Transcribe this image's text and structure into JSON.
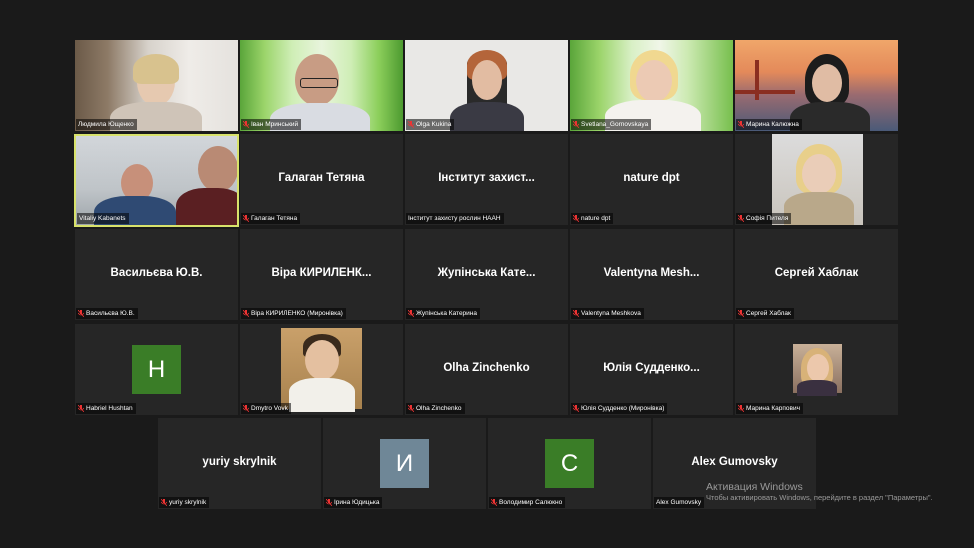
{
  "participants": [
    {
      "label": "Людмила Ющенко",
      "video": true
    },
    {
      "label": "Іван Мринський",
      "video": true
    },
    {
      "label": "Olga Kukina",
      "video": true
    },
    {
      "label": "Svetlana_Gornovskaya",
      "video": true
    },
    {
      "label": "Марина Калюжна",
      "video": true
    },
    {
      "label": "Vitaliy Kabanets",
      "video": true,
      "active": true
    },
    {
      "label": "Галаган Тетяна",
      "name": "Галаган Тетяна"
    },
    {
      "label": "Інститут захисту рослин НААН",
      "name": "Інститут захист..."
    },
    {
      "label": "nature dpt",
      "name": "nature dpt"
    },
    {
      "label": "Софія Пителя",
      "video": true
    },
    {
      "label": "Васильєва Ю.В.",
      "name": "Васильєва Ю.В."
    },
    {
      "label": "Віра КИРИЛЕНКО (Миронівка)",
      "name": "Віра КИРИЛЕНК..."
    },
    {
      "label": "Жупінська Катерина",
      "name": "Жупінська Кате..."
    },
    {
      "label": "Valentyna Meshkova",
      "name": "Valentyna Mesh..."
    },
    {
      "label": "Сергей Хаблак",
      "name": "Сергей Хаблак"
    },
    {
      "label": "Habriel Hushtan",
      "initial": "H",
      "color": "#3a7d27"
    },
    {
      "label": "Dmytro Vovk",
      "video": true
    },
    {
      "label": "Olha Zinchenko",
      "name": "Olha Zinchenko"
    },
    {
      "label": "Юлія Судденко (Миронівка)",
      "name": "Юлія Судденко..."
    },
    {
      "label": "Марина Карпович",
      "video": true
    },
    {
      "label": "yuriy skrylnik",
      "name": "yuriy skrylnik"
    },
    {
      "label": "Ірина Юдицька",
      "initial": "И",
      "color": "#6f8797"
    },
    {
      "label": "Володимир Салюкно",
      "initial": "С",
      "color": "#3a7d27"
    },
    {
      "label": "Alex Gumovsky",
      "name": "Alex Gumovsky"
    }
  ],
  "watermark": {
    "title": "Активация Windows",
    "subtitle": "Чтобы активировать Windows, перейдите в раздел \"Параметры\"."
  }
}
